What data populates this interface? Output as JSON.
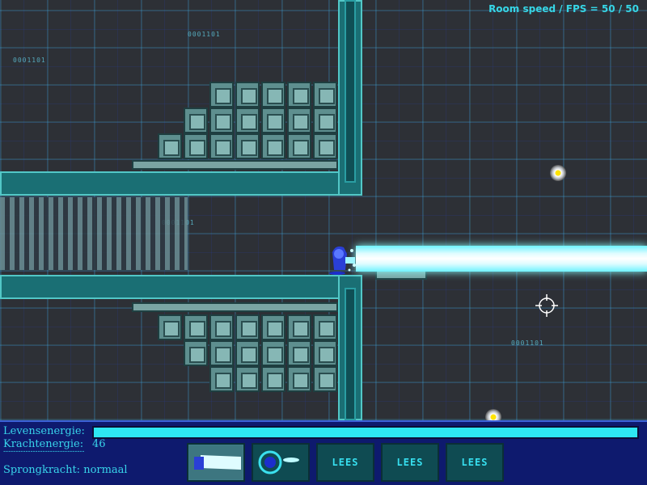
{
  "debug": {
    "fps_text": "Room speed / FPS = 50 / 50"
  },
  "scene": {
    "bits_labels": [
      "0001101",
      "0001101",
      "0001101",
      "0001101"
    ]
  },
  "hud": {
    "life_label": "Levensenergie:",
    "life_level": 1.0,
    "power_label": "Krachtenergie:",
    "power_value": "46",
    "separator": "---------------------------------",
    "jump_label": "Sprongkracht: normaal",
    "slots": [
      "",
      "",
      "LEES",
      "LEES",
      "LEES"
    ],
    "slot_icons": [
      "beam-weapon-icon",
      "orb-weapon-icon"
    ]
  },
  "colors": {
    "accent": "#36d6e6",
    "hud_bg": "#0e1a6e",
    "beam": "#dffcff"
  }
}
